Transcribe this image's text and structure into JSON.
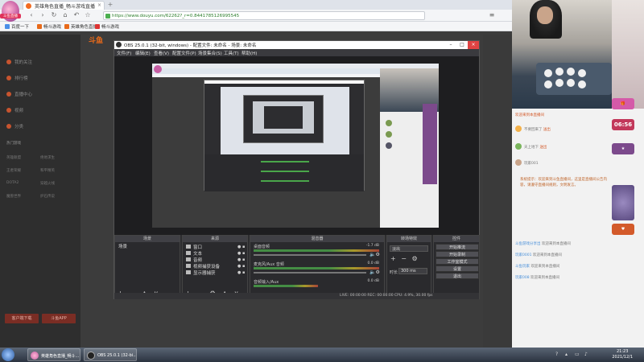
{
  "browser": {
    "badge": "斗鱼直播",
    "tabs": [
      {
        "label": "英雄角色直播_畅斗游戏直播"
      }
    ],
    "address": "https://www.douyu.com/62262?_r=0.8441785126995545",
    "bookmarks": [
      "百度一下",
      "畅斗游戏",
      "英雄角色直播",
      "畅斗游戏"
    ]
  },
  "site": {
    "logo": "斗鱼",
    "nav": [
      {
        "label": "我的关注",
        "icon": "heart-icon"
      },
      {
        "label": "排行榜",
        "icon": "rank-icon"
      },
      {
        "label": "直播中心",
        "icon": "live-icon"
      },
      {
        "label": "视频",
        "icon": "video-icon"
      },
      {
        "label": "分类",
        "icon": "category-icon"
      }
    ],
    "nav_section": "热门游戏",
    "nav_games": [
      "英雄联盟",
      "绝地求生",
      "王者荣耀",
      "和平精英",
      "DOTA2",
      "穿越火线",
      "魔兽世界",
      "炉石传说"
    ],
    "download_btn": "客户端下载",
    "app_btn": "斗鱼APP"
  },
  "obs": {
    "title": "OBS 25.0.1 (32-bit, windows) - 配置文件: 未命名 - 场景: 未命名",
    "menu": [
      "文件(F)",
      "编辑(E)",
      "查看(V)",
      "配置文件(P)",
      "场景集合(S)",
      "工具(T)",
      "帮助(H)"
    ],
    "docks": {
      "scenes": "场景",
      "sources": "来源",
      "mixer": "混音器",
      "transitions": "转场特效",
      "controls": "控件"
    },
    "scene_item": "场景",
    "sources": [
      "窗口",
      "文本",
      "音频",
      "视频捕获设备",
      "显示器捕获"
    ],
    "mixer": [
      {
        "label": "桌面音频",
        "db": "-1.7 dB"
      },
      {
        "label": "麦克风/Aux 音频",
        "db": "0.0 dB"
      },
      {
        "label": "音频输入/Aux",
        "db": "0.0 dB"
      }
    ],
    "transition": "淡出",
    "duration_label": "时长",
    "duration": "300 ms",
    "controls": [
      "开始推流",
      "开始录制",
      "工作室模式",
      "设置",
      "退出"
    ],
    "status": "LIVE: 00:00:00     REC: 00:00:00     CPU: 4.9%, 30.00 fps"
  },
  "chat": {
    "notice": "欢迎来到本直播间",
    "users": [
      {
        "name": "不要回来了",
        "level": "送出"
      },
      {
        "name": "天上地下",
        "level": "送出"
      },
      {
        "name": "玩家001",
        "level": ""
      }
    ],
    "announcement": "系统提示：欢迎来到斗鱼直播间，这里是直播间公告内容，请遵守直播间规则，文明发言。",
    "messages": [
      {
        "name": "斗鱼游戏分享出",
        "text": "欢迎来到本直播间"
      },
      {
        "name": "玩家0001",
        "text": "欢迎来到本直播间"
      },
      {
        "name": "斗鱼玩家",
        "text": "欢迎来到本直播间"
      },
      {
        "name": "玩家008",
        "text": "欢迎来到本直播间"
      }
    ],
    "timer": "06:56"
  },
  "taskbar": {
    "apps": [
      "英雄角色直播_畅斗...",
      "OBS 25.0.1 (32-bi..."
    ],
    "time": "21:23",
    "date": "2021/12/1"
  }
}
